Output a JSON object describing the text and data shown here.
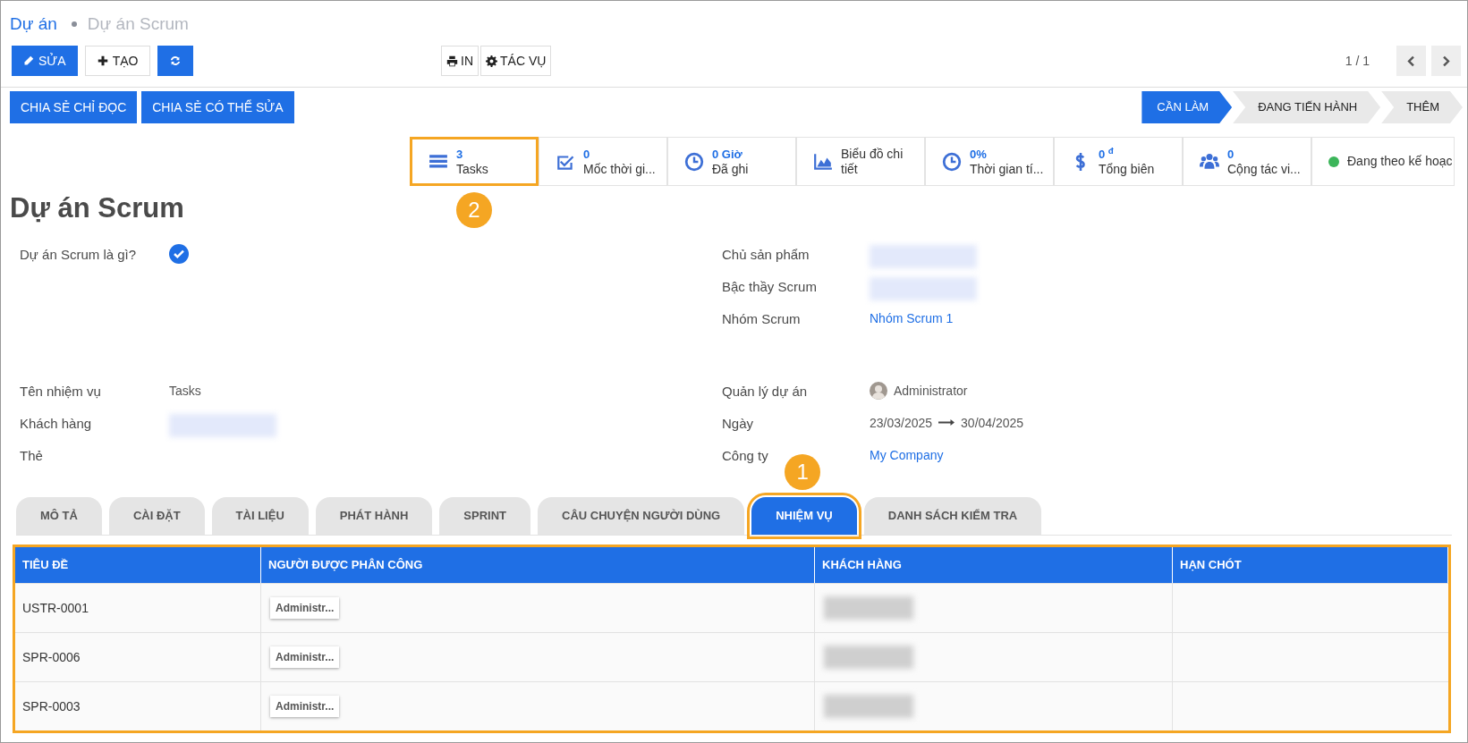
{
  "breadcrumb": [
    {
      "label": "Dự án",
      "kind": "link"
    },
    {
      "label": "Dự án Scrum",
      "kind": "current"
    }
  ],
  "toolbar": [
    {
      "label": "SỬA",
      "kind": "primary"
    },
    {
      "label": "TẠO",
      "kind": "secondary"
    },
    {
      "kind": "refresh"
    }
  ],
  "toolbar_middle": [
    {
      "label": "IN"
    },
    {
      "label": "TÁC VỤ"
    }
  ],
  "pager": {
    "text": "1 / 1"
  },
  "share_buttons": [
    "CHIA SẺ CHỈ ĐỌC",
    "CHIA SẺ CÓ THỂ SỬA"
  ],
  "stages": [
    {
      "label": "CẦN LÀM",
      "selected": true
    },
    {
      "label": "ĐANG TIẾN HÀNH",
      "selected": false
    },
    {
      "label": "THÊM",
      "selected": false
    }
  ],
  "stats": [
    {
      "kind": "tasks",
      "value": "3",
      "label": "Tasks",
      "highlighted": true,
      "callout": "2"
    },
    {
      "kind": "milestone",
      "value": "0",
      "label": "Mốc thời gi...",
      "highlighted": false
    },
    {
      "kind": "clock",
      "value": "0 Giờ",
      "label": "Đã ghi",
      "highlighted": false
    },
    {
      "kind": "chart",
      "label": "Biểu đồ chi tiết",
      "highlighted": false
    },
    {
      "kind": "clock",
      "value": "0%",
      "label": "Thời gian tí...",
      "highlighted": false
    },
    {
      "kind": "dollar",
      "value": "0 $^{đ}$",
      "label": "Tổng biên",
      "highlighted": false
    },
    {
      "kind": "users",
      "value": "0",
      "label": "Cộng tác vi...",
      "highlighted": false
    },
    {
      "kind": "status",
      "label": "Đang theo kế hoạc",
      "color": "#3cb55a",
      "highlighted": false
    }
  ],
  "title": "Dự án Scrum",
  "left_fields": [
    {
      "label": "Dự án Scrum là gì?",
      "kind": "checkbox",
      "checked": true
    },
    {
      "label": "Tên nhiệm vụ",
      "kind": "text",
      "value": "Tasks"
    },
    {
      "label": "Khách hàng",
      "kind": "blurred"
    },
    {
      "label": "Thẻ",
      "kind": "empty"
    }
  ],
  "right_fields": [
    {
      "label": "Chủ sản phẩm",
      "kind": "blurred"
    },
    {
      "label": "Bậc thầy Scrum",
      "kind": "blurred"
    },
    {
      "label": "Nhóm Scrum",
      "kind": "link",
      "value": "Nhóm Scrum 1"
    },
    {
      "label": "Quản lý dự án",
      "kind": "user",
      "value": "Administrator"
    },
    {
      "label": "Ngày",
      "kind": "daterange",
      "start": "23/03/2025",
      "end": "30/04/2025"
    },
    {
      "label": "Công ty",
      "kind": "link",
      "value": "My Company"
    }
  ],
  "tabs": [
    {
      "label": "MÔ TẢ",
      "selected": false,
      "highlighted": false
    },
    {
      "label": "CÀI ĐẶT",
      "selected": false,
      "highlighted": false
    },
    {
      "label": "TÀI LIỆU",
      "selected": false,
      "highlighted": false
    },
    {
      "label": "PHÁT HÀNH",
      "selected": false,
      "highlighted": false
    },
    {
      "label": "SPRINT",
      "selected": false,
      "highlighted": false
    },
    {
      "label": "CÂU CHUYỆN NGƯỜI DÙNG",
      "selected": false,
      "highlighted": false
    },
    {
      "label": "NHIỆM VỤ",
      "selected": true,
      "highlighted": true,
      "callout": "1"
    },
    {
      "label": "DANH SÁCH KIỂM TRA",
      "selected": false,
      "highlighted": false
    }
  ],
  "table": {
    "highlighted": true,
    "columns": [
      "TIÊU ĐỀ",
      "NGƯỜI ĐƯỢC PHÂN CÔNG",
      "KHÁCH HÀNG",
      "HẠN CHÓT"
    ],
    "rows": [
      {
        "title": "USTR-0001",
        "assignee": "Administr..."
      },
      {
        "title": "SPR-0006",
        "assignee": "Administr..."
      },
      {
        "title": "SPR-0003",
        "assignee": "Administr..."
      }
    ]
  }
}
